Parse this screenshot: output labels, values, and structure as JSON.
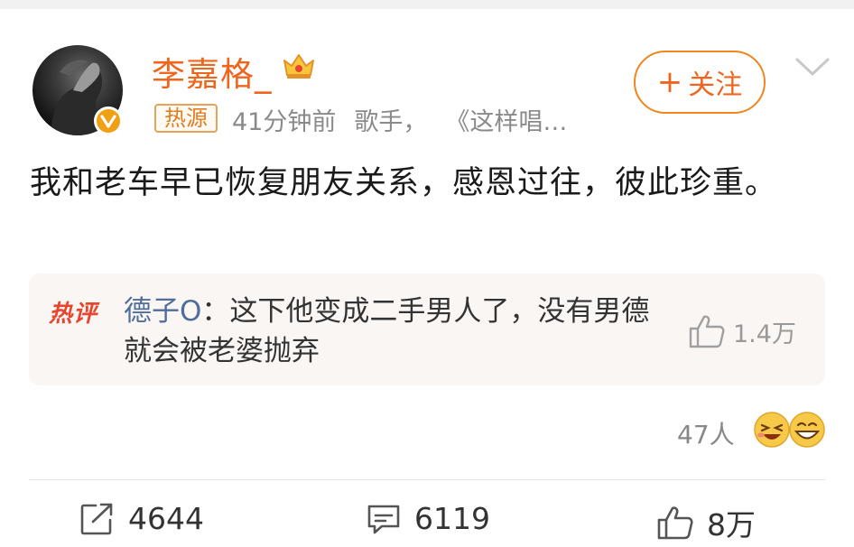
{
  "post": {
    "author": {
      "name": "李嘉格_",
      "avatar_icon": "avatar-photo",
      "verified_icon": "verified-v-icon",
      "crown_icon": "crown-icon"
    },
    "hot_tag": "热源",
    "time": "41分钟前",
    "source_label": "歌手，",
    "source_title": "《这样唱…",
    "follow_label": "关注",
    "text": "我和老车早已恢复朋友关系，感恩过往，彼此珍重。"
  },
  "hot_comment": {
    "label": "热评",
    "commenter": "德子O",
    "separator": "：",
    "text": "这下他变成二手男人了，没有男德就会被老婆抛弃",
    "likes": "1.4万"
  },
  "reactions": {
    "count": "47人"
  },
  "actions": {
    "reposts": "4644",
    "comments": "6119",
    "likes": "8万"
  },
  "colors": {
    "accent": "#f0651e",
    "commenter": "#4f6e9b",
    "hot_label": "#e8452e"
  }
}
